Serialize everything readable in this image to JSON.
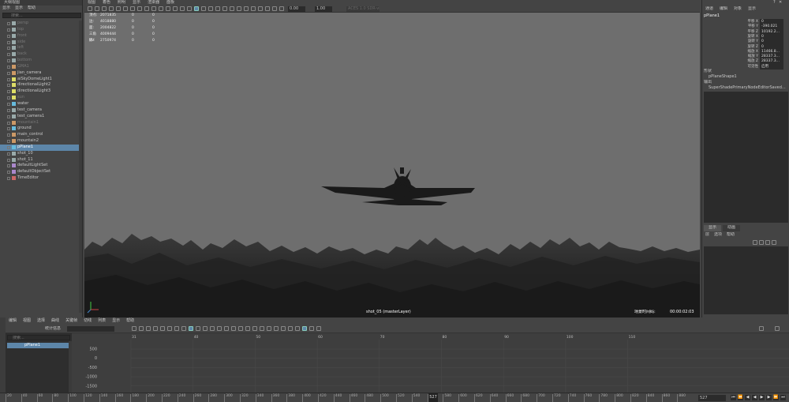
{
  "outliner": {
    "title": "大纲视图",
    "menu": [
      "显示",
      "显示",
      "帮助"
    ],
    "search_placeholder": "搜索...",
    "items": [
      {
        "label": "persp",
        "icon": "camera-icon",
        "state": "dim"
      },
      {
        "label": "top",
        "icon": "camera-icon",
        "state": "dim"
      },
      {
        "label": "front",
        "icon": "camera-icon",
        "state": "dim"
      },
      {
        "label": "side",
        "icon": "camera-icon",
        "state": "dim"
      },
      {
        "label": "left",
        "icon": "camera-icon",
        "state": "dim"
      },
      {
        "label": "back",
        "icon": "camera-icon",
        "state": "dim"
      },
      {
        "label": "bottom",
        "icon": "camera-icon",
        "state": "dim"
      },
      {
        "label": "GMA1",
        "icon": "group-icon",
        "state": "dim"
      },
      {
        "label": "jian_camera",
        "icon": "group-icon",
        "state": "normal"
      },
      {
        "label": "aiSkyDomeLight1",
        "icon": "light-icon",
        "state": "normal"
      },
      {
        "label": "directionalLight2",
        "icon": "light-icon",
        "state": "normal"
      },
      {
        "label": "directionalLight3",
        "icon": "light-icon",
        "state": "normal"
      },
      {
        "label": "sun",
        "icon": "light-icon",
        "state": "dim"
      },
      {
        "label": "water",
        "icon": "mesh-icon",
        "state": "normal"
      },
      {
        "label": "test_camera",
        "icon": "camera-icon",
        "state": "normal"
      },
      {
        "label": "test_camera1",
        "icon": "camera-icon",
        "state": "normal"
      },
      {
        "label": "mountain1",
        "icon": "group-icon",
        "state": "dim"
      },
      {
        "label": "ground",
        "icon": "mesh-icon",
        "state": "normal"
      },
      {
        "label": "main_control",
        "icon": "group-icon",
        "state": "normal"
      },
      {
        "label": "mountain2",
        "icon": "group-icon",
        "state": "normal"
      },
      {
        "label": "pPlane1",
        "icon": "mesh-icon",
        "state": "selected"
      },
      {
        "label": "shot_10",
        "icon": "camera-icon",
        "state": "normal"
      },
      {
        "label": "shot_11",
        "icon": "camera-icon",
        "state": "normal"
      },
      {
        "label": "defaultLightSet",
        "icon": "set-icon",
        "state": "normal"
      },
      {
        "label": "defaultObjectSet",
        "icon": "set-icon",
        "state": "normal"
      },
      {
        "label": "TimeEditor",
        "icon": "editor-icon",
        "state": "normal"
      }
    ]
  },
  "viewport": {
    "menu": [
      "视图",
      "着色",
      "照明",
      "显示",
      "渲染器",
      "面板"
    ],
    "toolbar_fields": [
      "0.00",
      "1.00",
      "ACES 1.0 SDR-video (sRGB)"
    ],
    "stats": [
      {
        "k": "顶点:",
        "v": "2071835",
        "a": "0",
        "b": "0"
      },
      {
        "k": "边:",
        "v": "4018880",
        "a": "0",
        "b": "0"
      },
      {
        "k": "面:",
        "v": "2004822",
        "a": "0",
        "b": "0"
      },
      {
        "k": "三角形:",
        "v": "4009444",
        "a": "0",
        "b": "0"
      },
      {
        "k": "UV:",
        "v": "2750974",
        "a": "0",
        "b": "0"
      }
    ],
    "camera_label": "shot_05 (masterLayer)",
    "fps_label": "场景时间码:",
    "timecode": "00:00:02:03"
  },
  "channelbox": {
    "menu": [
      "通道",
      "编辑",
      "对象",
      "显示"
    ],
    "object_name": "pPlane1",
    "channels": [
      {
        "name": "平移 X",
        "value": "0"
      },
      {
        "name": "平移 Y",
        "value": "-390.021"
      },
      {
        "name": "平移 Z",
        "value": "10192.2..."
      },
      {
        "name": "旋转 X",
        "value": "0"
      },
      {
        "name": "旋转 Y",
        "value": "0"
      },
      {
        "name": "旋转 Z",
        "value": "0"
      },
      {
        "name": "缩放 X",
        "value": "11466.8..."
      },
      {
        "name": "缩放 Y",
        "value": "28337.3..."
      },
      {
        "name": "缩放 Z",
        "value": "28337.3..."
      },
      {
        "name": "可见性",
        "value": "启用"
      }
    ],
    "shapes_header": "形状",
    "shape_name": "pPlaneShape1",
    "inputs_header": "输出",
    "input_name": "SuperShadePrimaryNodeEditorSaved...",
    "layer_tabs": [
      "显示",
      "动画"
    ],
    "layer_menu": [
      "层",
      "选项",
      "帮助"
    ]
  },
  "graph_editor": {
    "menu": [
      "编辑",
      "视图",
      "选择",
      "曲线",
      "关键帧",
      "切线",
      "列表",
      "显示",
      "帮助"
    ],
    "stats_label": "统计信息",
    "search_placeholder": "搜索...",
    "outliner_item": "pPlane1",
    "y_ticks": [
      "500",
      "0",
      "-500",
      "-1000",
      "-1500"
    ],
    "x_ticks": [
      "31",
      "40",
      "50",
      "60",
      "70",
      "80",
      "90",
      "100",
      "110"
    ]
  },
  "timeslider": {
    "ticks": [
      "20",
      "40",
      "60",
      "80",
      "100",
      "120",
      "140",
      "160",
      "180",
      "200",
      "220",
      "240",
      "260",
      "280",
      "300",
      "320",
      "340",
      "360",
      "380",
      "400",
      "420",
      "440",
      "460",
      "480",
      "500",
      "520",
      "540",
      "560",
      "580",
      "600",
      "620",
      "640",
      "660",
      "680",
      "700",
      "720",
      "740",
      "760",
      "780",
      "800",
      "820",
      "840",
      "860",
      "880"
    ],
    "current_frame": "527",
    "frame_field": "527"
  }
}
